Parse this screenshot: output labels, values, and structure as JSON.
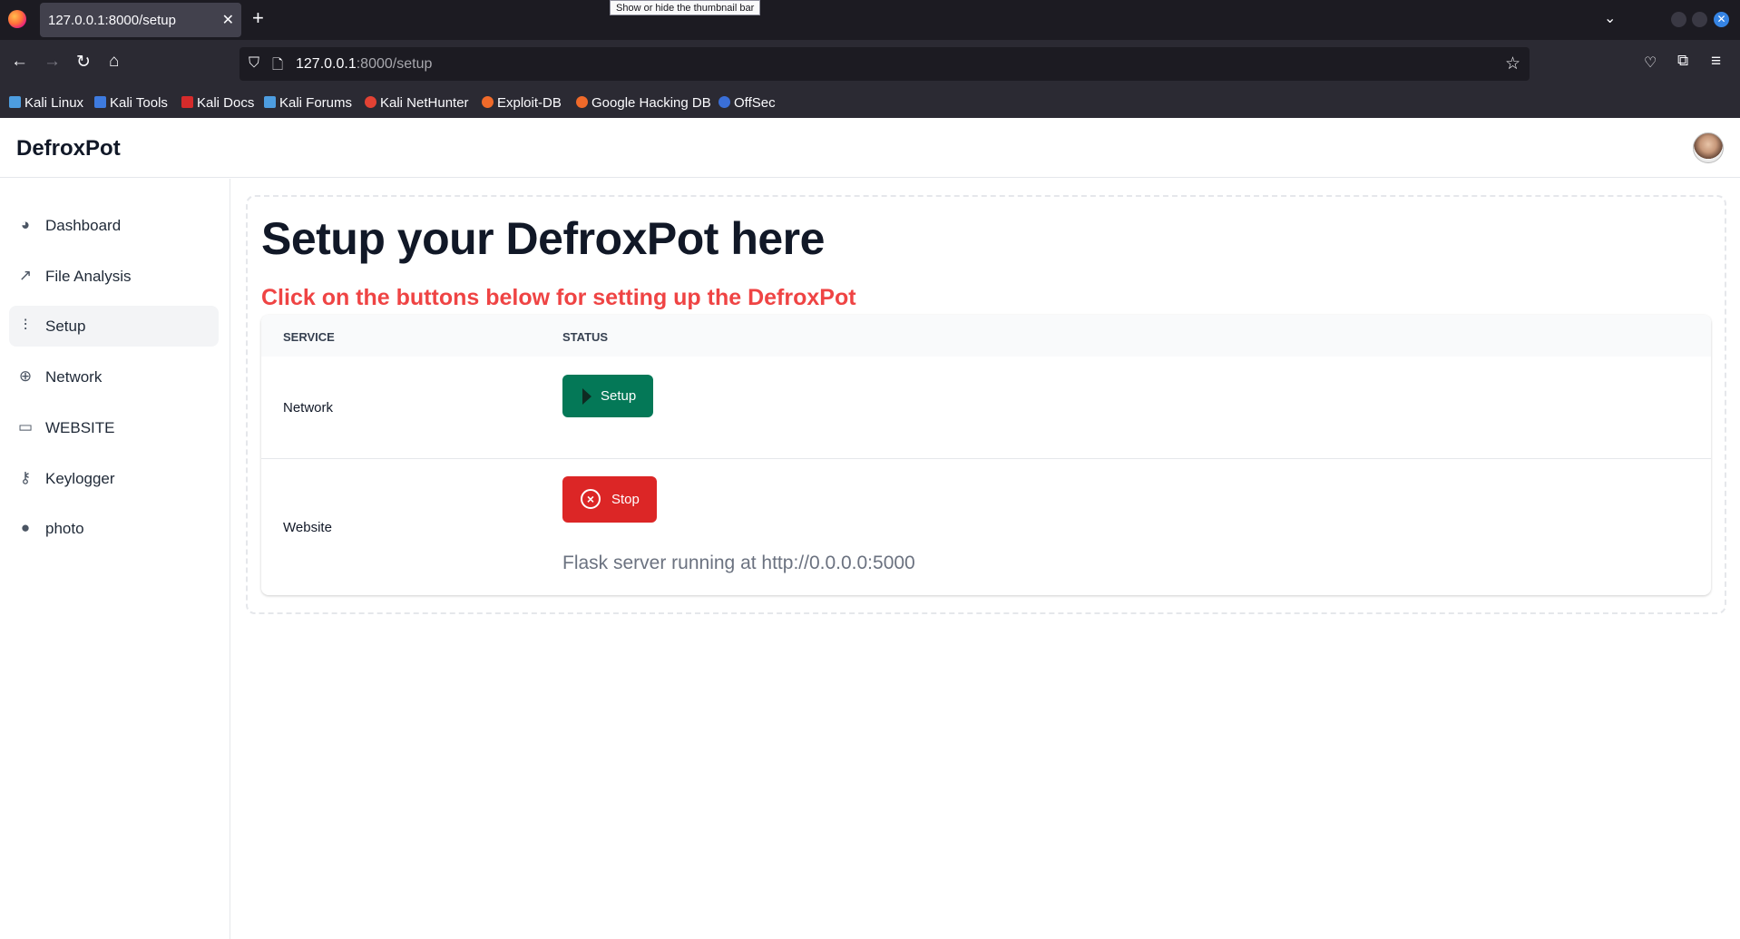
{
  "browser": {
    "tab_title": "127.0.0.1:8000/setup",
    "tooltip": "Show or hide the thumbnail bar",
    "url_host": "127.0.0.1",
    "url_path": ":8000/setup",
    "bookmarks": [
      {
        "label": "Kali Linux",
        "icon_color": "#4d9de0"
      },
      {
        "label": "Kali Tools",
        "icon_color": "#3e7be0"
      },
      {
        "label": "Kali Docs",
        "icon_color": "#d52b2b"
      },
      {
        "label": "Kali Forums",
        "icon_color": "#4d9de0"
      },
      {
        "label": "Kali NetHunter",
        "icon_color": "#e34234"
      },
      {
        "label": "Exploit-DB",
        "icon_color": "#f06a2a"
      },
      {
        "label": "Google Hacking DB",
        "icon_color": "#f06a2a"
      },
      {
        "label": "OffSec",
        "icon_color": "#3a6fd8"
      }
    ]
  },
  "app": {
    "brand": "DefroxPot"
  },
  "sidebar": {
    "items": [
      {
        "label": "Dashboard",
        "icon": "pie-chart-icon"
      },
      {
        "label": "File Analysis",
        "icon": "trend-icon"
      },
      {
        "label": "Setup",
        "icon": "sliders-icon",
        "active": true
      },
      {
        "label": "Network",
        "icon": "globe-icon"
      },
      {
        "label": "WEBSITE",
        "icon": "monitor-icon"
      },
      {
        "label": "Keylogger",
        "icon": "key-icon"
      },
      {
        "label": "photo",
        "icon": "user-icon"
      }
    ]
  },
  "main": {
    "title": "Setup your DefroxPot here",
    "subtitle": "Click on the buttons below for setting up the DefroxPot",
    "table": {
      "headers": [
        "SERVICE",
        "STATUS"
      ],
      "rows": [
        {
          "service": "Network",
          "button": "Setup"
        },
        {
          "service": "Website",
          "button": "Stop",
          "status": "Flask server running at http://0.0.0.0:5000"
        }
      ]
    }
  },
  "colors": {
    "setup_button": "#047857",
    "stop_button": "#dc2626",
    "subtitle": "#ef4444"
  }
}
